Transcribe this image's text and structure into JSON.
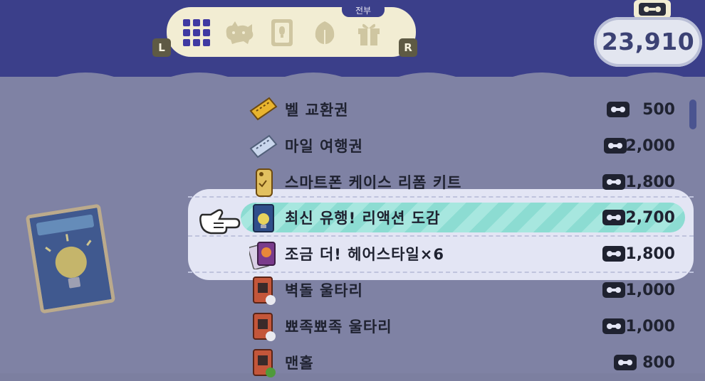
{
  "header": {
    "tab_label": "전부",
    "tabs": [
      {
        "id": "grid-icon",
        "selected": true
      },
      {
        "id": "raccoon-icon",
        "selected": false
      },
      {
        "id": "card-icon",
        "selected": false
      },
      {
        "id": "leaf-icon",
        "selected": false
      },
      {
        "id": "gift-icon",
        "selected": false
      }
    ],
    "left_button": "L",
    "right_button": "R"
  },
  "points": {
    "value": "23,910",
    "icon": "miles-ticket-icon"
  },
  "items": [
    {
      "name": "벨 교환권",
      "price": "500",
      "icon": "bell-ticket-icon"
    },
    {
      "name": "마일 여행권",
      "price": "2,000",
      "icon": "ticket-icon"
    },
    {
      "name": "스마트폰 케이스 리폼 키트",
      "price": "1,800",
      "icon": "phone-case-icon"
    },
    {
      "name": "최신 유행! 리액션 도감",
      "price": "2,700",
      "icon": "reaction-book-icon",
      "selected": true
    },
    {
      "name": "조금 더! 헤어스타일×6",
      "price": "1,800",
      "icon": "hairstyle-book-icon"
    },
    {
      "name": "벽돌 울타리",
      "price": "1,000",
      "icon": "fence-icon"
    },
    {
      "name": "뾰족뾰족 울타리",
      "price": "1,000",
      "icon": "fence-icon"
    },
    {
      "name": "맨홀",
      "price": "800",
      "icon": "manhole-icon"
    }
  ],
  "colors": {
    "header": "#3b3f8a",
    "selected": "#8cdcd2",
    "panel": "#7f82a4"
  }
}
